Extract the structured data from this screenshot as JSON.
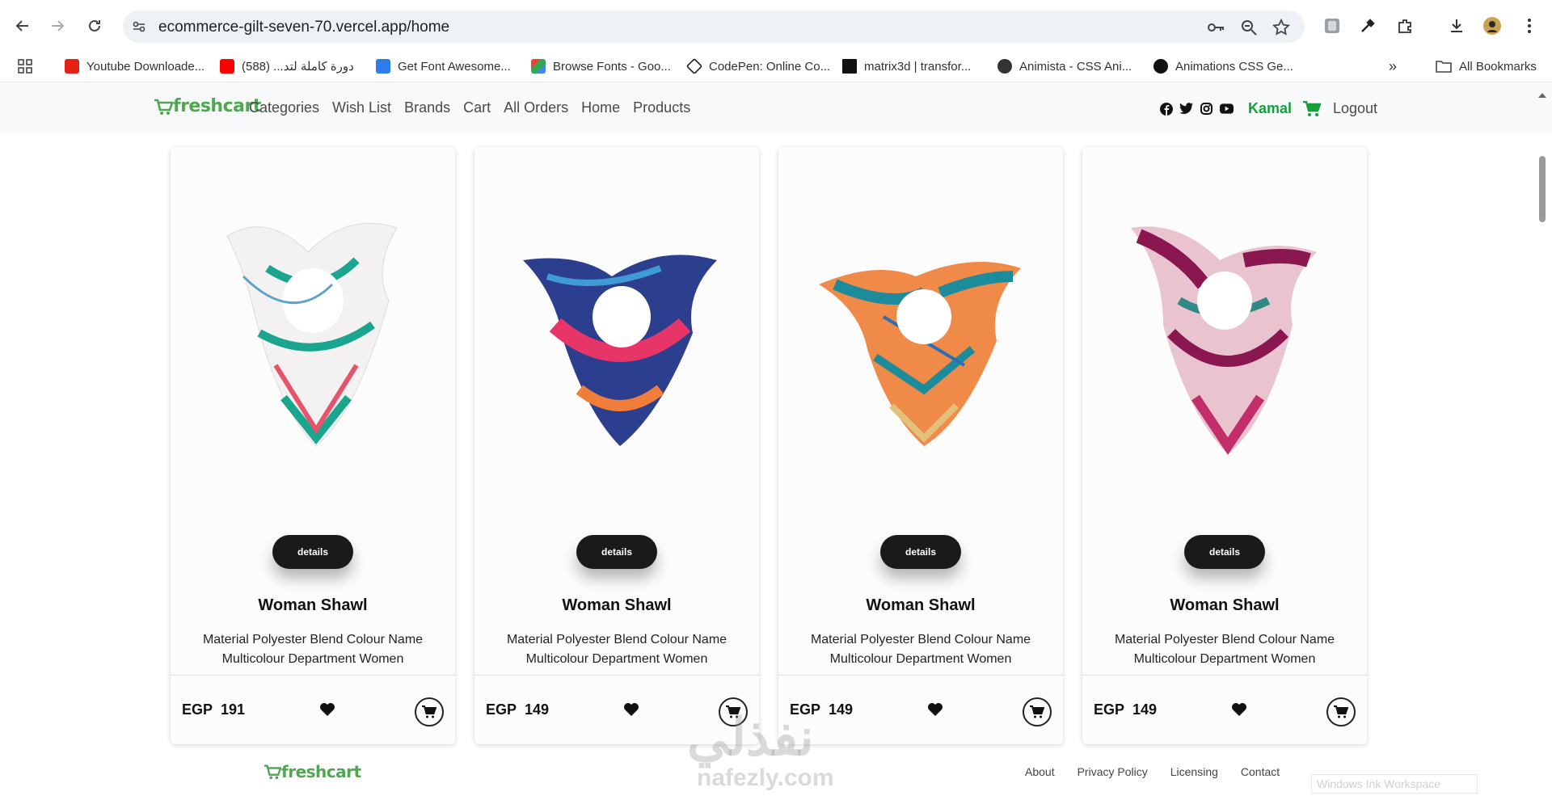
{
  "browser": {
    "url": "ecommerce-gilt-seven-70.vercel.app/home",
    "bookmarks": [
      {
        "label": "Youtube Downloade...",
        "color": "#e62117"
      },
      {
        "label": "دورة كاملة لتد... (588)",
        "color": "#ff0000"
      },
      {
        "label": "Get Font Awesome...",
        "color": "#2b7de9"
      },
      {
        "label": "Browse Fonts - Goo...",
        "color": "#34a853"
      },
      {
        "label": "CodePen: Online Co...",
        "color": "#1e1f26"
      },
      {
        "label": "matrix3d | transfor...",
        "color": "#111111"
      },
      {
        "label": "Animista - CSS Ani...",
        "color": "#333333"
      },
      {
        "label": "Animations CSS Ge...",
        "color": "#111111"
      }
    ],
    "all_bookmarks": "All Bookmarks"
  },
  "site": {
    "logo": "freshcart",
    "nav": [
      "Categories",
      "Wish List",
      "Brands",
      "Cart",
      "All Orders",
      "Home",
      "Products"
    ],
    "social_icons": [
      "facebook-icon",
      "twitter-icon",
      "instagram-icon",
      "youtube-icon"
    ],
    "user": "Kamal",
    "logout": "Logout",
    "accent": "#11a13a"
  },
  "products": [
    {
      "title": "Woman Shawl",
      "desc": "Material Polyester Blend Colour Name Multicolour Department Women",
      "currency": "EGP",
      "price": "191",
      "details": "details",
      "palette": [
        "#f4f1f3",
        "#1aa58e",
        "#e6546c",
        "#5fa2c9"
      ]
    },
    {
      "title": "Woman Shawl",
      "desc": "Material Polyester Blend Colour Name Multicolour Department Women",
      "currency": "EGP",
      "price": "149",
      "details": "details",
      "palette": [
        "#2c3f8f",
        "#e83567",
        "#f07d3a",
        "#3f9ad6"
      ]
    },
    {
      "title": "Woman Shawl",
      "desc": "Material Polyester Blend Colour Name Multicolour Department Women",
      "currency": "EGP",
      "price": "149",
      "details": "details",
      "palette": [
        "#f08a48",
        "#1c8b9c",
        "#e3c07a",
        "#2d6fb2"
      ]
    },
    {
      "title": "Woman Shawl",
      "desc": "Material Polyester Blend Colour Name Multicolour Department Women",
      "currency": "EGP",
      "price": "149",
      "details": "details",
      "palette": [
        "#8a1750",
        "#e9c4cf",
        "#2f8a86",
        "#c22d6a"
      ]
    }
  ],
  "footer": {
    "logo": "freshcart",
    "links": [
      "About",
      "Privacy Policy",
      "Licensing",
      "Contact"
    ]
  },
  "watermark": {
    "arabic": "نفذلي",
    "site": "nafezly.com",
    "windows": "Windows Ink Workspace"
  }
}
